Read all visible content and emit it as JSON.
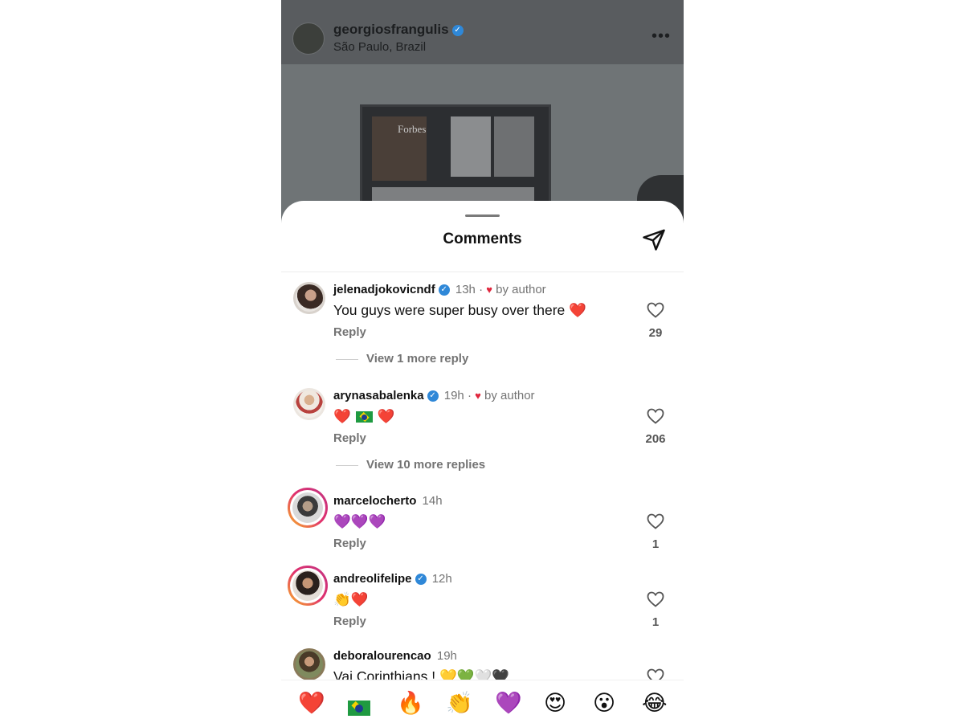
{
  "post": {
    "username": "georgiosfrangulis",
    "location": "São Paulo, Brazil",
    "more_label": "•••",
    "image_caption": "Forbes"
  },
  "sheet": {
    "title": "Comments"
  },
  "comments": [
    {
      "username": "jelenadjokovicndf",
      "verified": true,
      "time": "13h",
      "by_author": "by author",
      "text": "You guys were super busy over there ❤️",
      "reply_label": "Reply",
      "likes": "29",
      "view_replies": "View 1 more reply"
    },
    {
      "username": "arynasabalenka",
      "verified": true,
      "time": "19h",
      "by_author": "by author",
      "text_before": "❤️",
      "text_after": "❤️",
      "reply_label": "Reply",
      "likes": "206",
      "view_replies": "View 10 more replies"
    },
    {
      "username": "marcelocherto",
      "verified": false,
      "time": "14h",
      "text": "💜💜💜",
      "reply_label": "Reply",
      "likes": "1"
    },
    {
      "username": "andreolifelipe",
      "verified": true,
      "time": "12h",
      "text": "👏❤️",
      "reply_label": "Reply",
      "likes": "1"
    },
    {
      "username": "deboralourencao",
      "verified": false,
      "time": "19h",
      "text": "Vai Corinthians ! 💛💚🤍🖤"
    }
  ],
  "reactions": [
    "❤️",
    "🇧🇷",
    "🔥",
    "👏",
    "💜",
    "😍",
    "😮",
    "😂"
  ],
  "colors": {
    "verified": "#2f88d8",
    "heart": "#e0263d",
    "secondary_text": "#737373",
    "story_ring": [
      "#f9b826",
      "#e1306c",
      "#c13584"
    ]
  }
}
